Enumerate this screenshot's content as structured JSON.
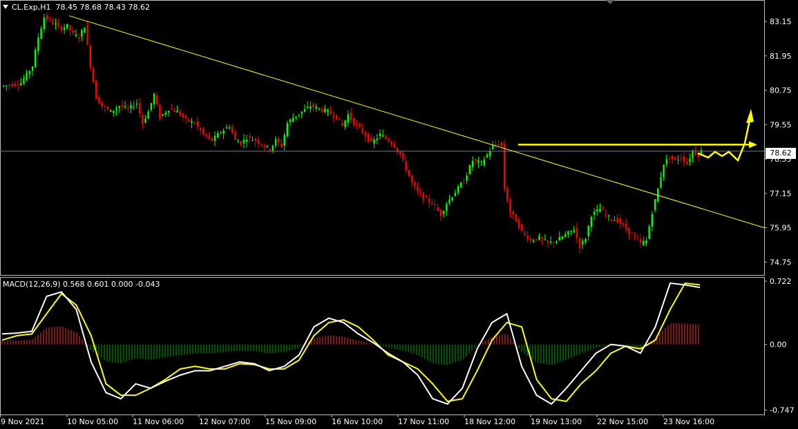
{
  "header": {
    "symbol_label": "CL.Exp,H1",
    "ohlc": "78.45 78.68 78.43 78.62"
  },
  "macd_header": {
    "label": "MACD(12,26,9) 0.568 0.601 0.000 -0.043"
  },
  "current_price_label": "78.62",
  "colors": {
    "bull": "#00ff00",
    "bear": "#ff0000",
    "trend": "#ffff00",
    "macd_main": "#ffffff",
    "macd_signal": "#ffff00",
    "hist_pos": "#ff3030",
    "hist_neg": "#00aa00",
    "grid": "#c0c0c0",
    "price_line": "#708090"
  },
  "chart_data": [
    {
      "type": "candlestick",
      "title": "CL.Exp,H1",
      "y_ticks": [
        "83.15",
        "81.95",
        "80.75",
        "79.55",
        "78.35",
        "77.15",
        "75.95",
        "74.75"
      ],
      "ylim": [
        74.3,
        83.9
      ],
      "x_ticks": [
        "9 Nov 2021",
        "10 Nov 05:00",
        "11 Nov 06:00",
        "12 Nov 07:00",
        "15 Nov 09:00",
        "16 Nov 10:00",
        "17 Nov 11:00",
        "18 Nov 12:00",
        "19 Nov 13:00",
        "22 Nov 15:00",
        "23 Nov 16:00"
      ],
      "close_path": [
        [
          0,
          80.9
        ],
        [
          6,
          81.0
        ],
        [
          10,
          81.6
        ],
        [
          12,
          82.6
        ],
        [
          14,
          83.3
        ],
        [
          17,
          83.1
        ],
        [
          20,
          82.9
        ],
        [
          22,
          83.0
        ],
        [
          24,
          82.7
        ],
        [
          26,
          82.6
        ],
        [
          28,
          83.0
        ],
        [
          30,
          81.6
        ],
        [
          32,
          80.5
        ],
        [
          34,
          80.2
        ],
        [
          37,
          80.0
        ],
        [
          40,
          80.2
        ],
        [
          43,
          80.1
        ],
        [
          46,
          80.3
        ],
        [
          48,
          79.6
        ],
        [
          50,
          80.0
        ],
        [
          52,
          80.6
        ],
        [
          54,
          79.8
        ],
        [
          57,
          80.1
        ],
        [
          60,
          80.0
        ],
        [
          63,
          79.7
        ],
        [
          66,
          79.6
        ],
        [
          69,
          79.2
        ],
        [
          72,
          79.0
        ],
        [
          75,
          79.3
        ],
        [
          78,
          79.5
        ],
        [
          80,
          79.0
        ],
        [
          82,
          78.9
        ],
        [
          84,
          79.1
        ],
        [
          87,
          79.0
        ],
        [
          90,
          78.8
        ],
        [
          92,
          78.7
        ],
        [
          94,
          79.0
        ],
        [
          96,
          78.8
        ],
        [
          98,
          79.6
        ],
        [
          100,
          79.8
        ],
        [
          103,
          80.0
        ],
        [
          106,
          80.2
        ],
        [
          109,
          80.1
        ],
        [
          112,
          80.0
        ],
        [
          115,
          79.8
        ],
        [
          117,
          79.5
        ],
        [
          119,
          79.9
        ],
        [
          121,
          79.6
        ],
        [
          124,
          79.3
        ],
        [
          127,
          78.9
        ],
        [
          130,
          79.2
        ],
        [
          133,
          79.0
        ],
        [
          135,
          78.8
        ],
        [
          137,
          78.5
        ],
        [
          139,
          78.0
        ],
        [
          141,
          77.5
        ],
        [
          143,
          77.2
        ],
        [
          145,
          77.0
        ],
        [
          148,
          76.8
        ],
        [
          151,
          76.4
        ],
        [
          153,
          76.8
        ],
        [
          156,
          77.2
        ],
        [
          159,
          77.6
        ],
        [
          162,
          78.3
        ],
        [
          165,
          78.2
        ],
        [
          167,
          78.5
        ],
        [
          169,
          78.8
        ],
        [
          171,
          78.9
        ],
        [
          172,
          78.8
        ],
        [
          173,
          77.3
        ],
        [
          175,
          76.5
        ],
        [
          177,
          76.2
        ],
        [
          179,
          75.8
        ],
        [
          182,
          75.5
        ],
        [
          185,
          75.6
        ],
        [
          188,
          75.4
        ],
        [
          191,
          75.5
        ],
        [
          194,
          75.7
        ],
        [
          197,
          75.9
        ],
        [
          199,
          75.3
        ],
        [
          201,
          75.6
        ],
        [
          203,
          76.4
        ],
        [
          206,
          76.6
        ],
        [
          209,
          76.3
        ],
        [
          212,
          76.2
        ],
        [
          215,
          75.9
        ],
        [
          218,
          75.6
        ],
        [
          220,
          75.4
        ],
        [
          222,
          75.5
        ],
        [
          224,
          76.5
        ],
        [
          226,
          77.3
        ],
        [
          228,
          78.2
        ],
        [
          230,
          78.4
        ],
        [
          232,
          78.3
        ],
        [
          234,
          78.4
        ],
        [
          236,
          78.2
        ],
        [
          238,
          78.6
        ],
        [
          240,
          78.5
        ],
        [
          241,
          78.62
        ]
      ],
      "trendline": [
        [
          83.35,
          "start"
        ],
        [
          75.95,
          "end"
        ]
      ],
      "resistance_level": 78.85,
      "current_price": 78.62
    },
    {
      "type": "line",
      "title": "MACD(12,26,9)",
      "y_ticks": [
        "0.722",
        "0.00",
        "-0.747"
      ],
      "ylim": [
        -0.8,
        0.77
      ],
      "series": [
        {
          "name": "MACD",
          "values": [
            0.12,
            0.13,
            0.15,
            0.55,
            0.6,
            0.4,
            -0.2,
            -0.55,
            -0.62,
            -0.45,
            -0.5,
            -0.42,
            -0.35,
            -0.3,
            -0.3,
            -0.25,
            -0.2,
            -0.22,
            -0.3,
            -0.25,
            -0.12,
            0.2,
            0.3,
            0.25,
            0.12,
            0.02,
            -0.1,
            -0.2,
            -0.35,
            -0.62,
            -0.68,
            -0.5,
            -0.05,
            0.25,
            0.35,
            -0.25,
            -0.58,
            -0.68,
            -0.5,
            -0.3,
            -0.1,
            0.0,
            -0.02,
            -0.1,
            0.2,
            0.7,
            0.68,
            0.65
          ]
        },
        {
          "name": "Signal",
          "values": [
            0.05,
            0.1,
            0.12,
            0.35,
            0.58,
            0.45,
            0.1,
            -0.45,
            -0.58,
            -0.58,
            -0.5,
            -0.4,
            -0.28,
            -0.25,
            -0.28,
            -0.28,
            -0.22,
            -0.23,
            -0.28,
            -0.28,
            -0.18,
            0.1,
            0.25,
            0.28,
            0.2,
            0.05,
            -0.12,
            -0.2,
            -0.28,
            -0.45,
            -0.65,
            -0.62,
            -0.3,
            0.05,
            0.25,
            0.2,
            -0.4,
            -0.62,
            -0.65,
            -0.45,
            -0.3,
            -0.1,
            -0.02,
            -0.05,
            0.05,
            0.4,
            0.7,
            0.68
          ]
        }
      ]
    }
  ]
}
